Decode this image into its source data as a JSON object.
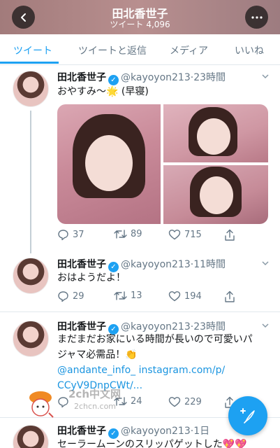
{
  "header": {
    "title": "田北香世子",
    "subtitle_label": "ツイート",
    "subtitle_count": "4,096"
  },
  "tabs": [
    {
      "label": "ツイート",
      "active": true
    },
    {
      "label": "ツイートと返信",
      "active": false
    },
    {
      "label": "メディア",
      "active": false
    },
    {
      "label": "いいね",
      "active": false
    }
  ],
  "tweets": [
    {
      "name": "田北香世子",
      "handle": "@kayoyon213",
      "time": "23時間",
      "text": "おやすみ〜🌟 (早寝)",
      "has_photos": true,
      "replies": "37",
      "retweets": "89",
      "likes": "715"
    },
    {
      "name": "田北香世子",
      "handle": "@kayoyon213",
      "time": "11時間",
      "text": "おはようだよ！",
      "replies": "29",
      "retweets": "13",
      "likes": "194"
    },
    {
      "name": "田北香世子",
      "handle": "@kayoyon213",
      "time": "23時間",
      "text_line1": "まだまだお家にいる時間が長いので可愛いパ",
      "text_line2": "ジャマ必需品！👏",
      "link_line1": "@andante_info_ instagram.com/p/",
      "link_line2": "CCyV9DnpCWt/...",
      "replies": "",
      "retweets": "24",
      "likes": "229"
    },
    {
      "name": "田北香世子",
      "handle": "@kayoyon213",
      "time": "1日",
      "text": "セーラームーンのスリッパゲットした💖💖"
    }
  ],
  "watermark": {
    "line1": "2ch中文网",
    "line2": "2chcn.com"
  },
  "colors": {
    "accent": "#1da1f2",
    "secondary_text": "#657786",
    "divider": "#e1e8ed"
  }
}
